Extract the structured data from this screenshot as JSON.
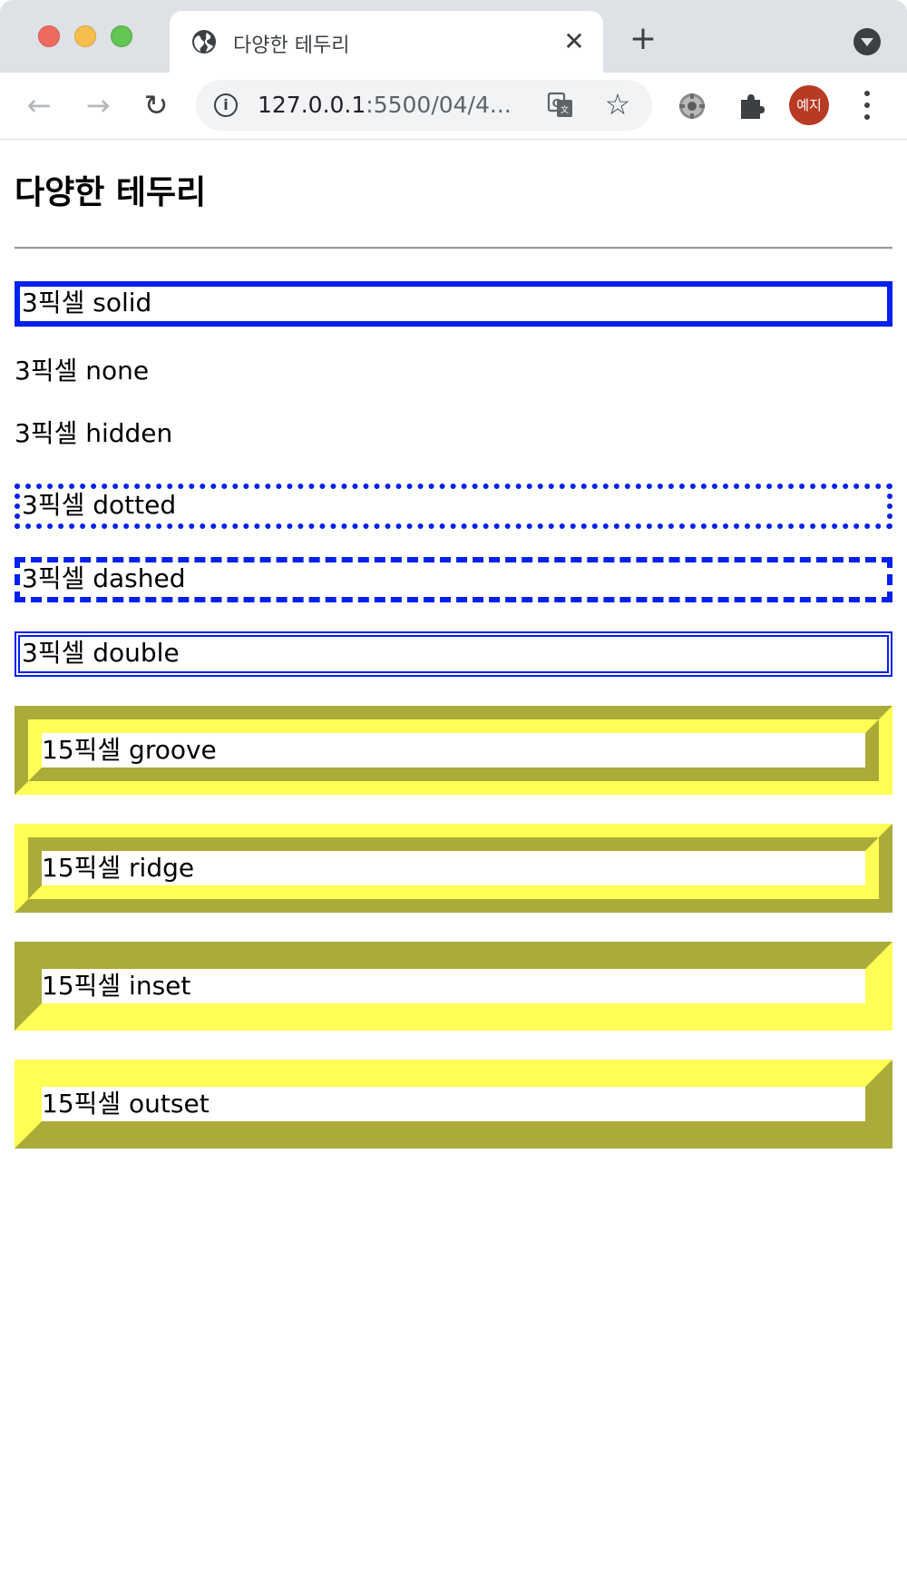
{
  "browser": {
    "tab": {
      "title": "다양한 테두리",
      "close_glyph": "✕"
    },
    "new_tab_glyph": "+",
    "url": {
      "host": "127.0.0.1",
      "path": ":5500/04/4..."
    },
    "profile": {
      "avatar_text": "예지",
      "avatar_color": "#b73a22"
    },
    "icons": {
      "back": "←",
      "forward": "→",
      "reload": "↻",
      "info": "i",
      "star": "☆"
    }
  },
  "page": {
    "heading": "다양한 테두리",
    "boxes": [
      {
        "label": "3픽셀 solid"
      },
      {
        "label": "3픽셀 none"
      },
      {
        "label": "3픽셀 hidden"
      },
      {
        "label": "3픽셀 dotted"
      },
      {
        "label": "3픽셀 dashed"
      },
      {
        "label": "3픽셀 double"
      },
      {
        "label": "15픽셀 groove"
      },
      {
        "label": "15픽셀 ridge"
      },
      {
        "label": "15픽셀 inset"
      },
      {
        "label": "15픽셀 outset"
      }
    ],
    "colors": {
      "thin_border": "#0020f0",
      "thick_border": "#ffff55"
    }
  }
}
